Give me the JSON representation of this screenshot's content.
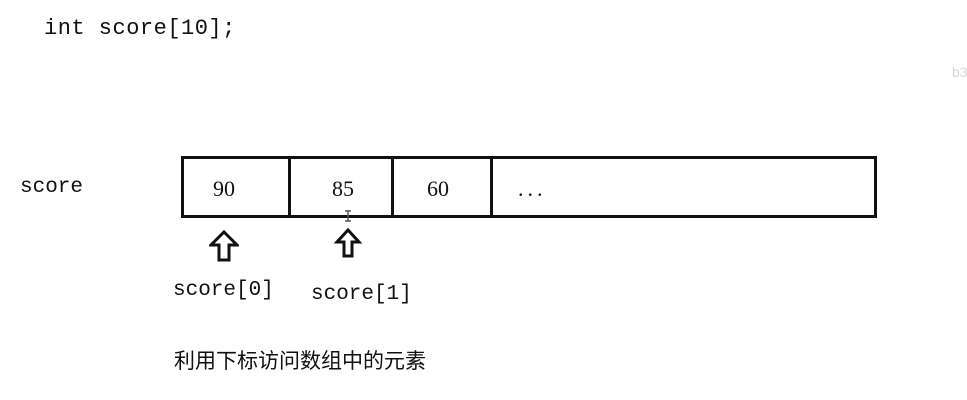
{
  "code": "int score[10];",
  "watermark": "b3",
  "array": {
    "name": "score",
    "cells": [
      "90",
      "85",
      "60",
      "..."
    ]
  },
  "indices": [
    "score[0]",
    "score[1]"
  ],
  "caption": "利用下标访问数组中的元素"
}
